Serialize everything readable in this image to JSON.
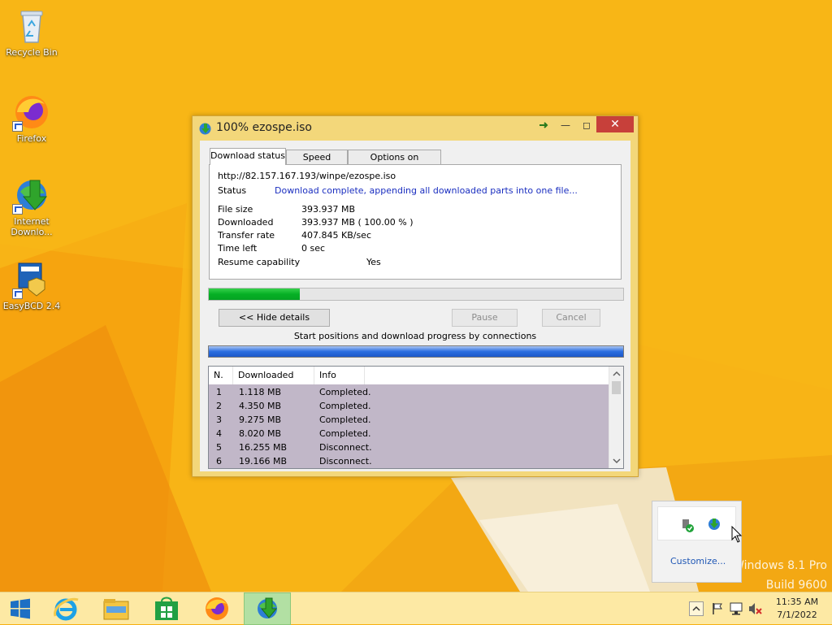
{
  "desktop": {
    "icons": [
      {
        "label": "Recycle Bin",
        "icon": "recycle-bin-icon"
      },
      {
        "label": "Firefox",
        "icon": "firefox-icon"
      },
      {
        "label": "Internet Downlo...",
        "icon": "idm-icon"
      },
      {
        "label": "EasyBCD 2.4",
        "icon": "easybcd-icon"
      }
    ],
    "watermark": {
      "line1": "Windows 8.1 Pro",
      "line2": "Build 9600"
    }
  },
  "window": {
    "title": "100% ezospe.iso",
    "tabs": [
      {
        "label": "Download status",
        "active": true
      },
      {
        "label": "Speed Limiter",
        "active": false
      },
      {
        "label": "Options on completion",
        "active": false
      }
    ],
    "url": "http://82.157.167.193/winpe/ezospe.iso",
    "status_label": "Status",
    "status_value": "Download complete, appending all downloaded parts into one file...",
    "details": [
      {
        "label": "File size",
        "value": "393.937  MB"
      },
      {
        "label": "Downloaded",
        "value": "393.937  MB  ( 100.00 % )"
      },
      {
        "label": "Transfer rate",
        "value": "407.845  KB/sec"
      },
      {
        "label": "Time left",
        "value": "0 sec"
      },
      {
        "label": "Resume capability",
        "value": "Yes"
      }
    ],
    "progress_fraction": 0.22,
    "buttons": {
      "hide_details": "<< Hide details",
      "pause": "Pause",
      "cancel": "Cancel"
    },
    "connections_label": "Start positions and download progress by connections",
    "list": {
      "columns": [
        "N.",
        "Downloaded",
        "Info"
      ],
      "rows": [
        [
          "1",
          "1.118  MB",
          "Completed."
        ],
        [
          "2",
          "4.350  MB",
          "Completed."
        ],
        [
          "3",
          "9.275  MB",
          "Completed."
        ],
        [
          "4",
          "8.020  MB",
          "Completed."
        ],
        [
          "5",
          "16.255  MB",
          "Disconnect."
        ],
        [
          "6",
          "19.166  MB",
          "Disconnect."
        ]
      ]
    }
  },
  "tray_popup": {
    "customize": "Customize..."
  },
  "taskbar": {
    "pinned": [
      "start-icon",
      "internet-explorer-icon",
      "file-explorer-icon",
      "store-icon",
      "firefox-icon",
      "idm-icon"
    ],
    "clock_time": "11:35 AM",
    "clock_date": "7/1/2022"
  },
  "colors": {
    "accent": "#f8b416",
    "status_blue": "#1b2fc0",
    "progress_green": "#06b025"
  }
}
